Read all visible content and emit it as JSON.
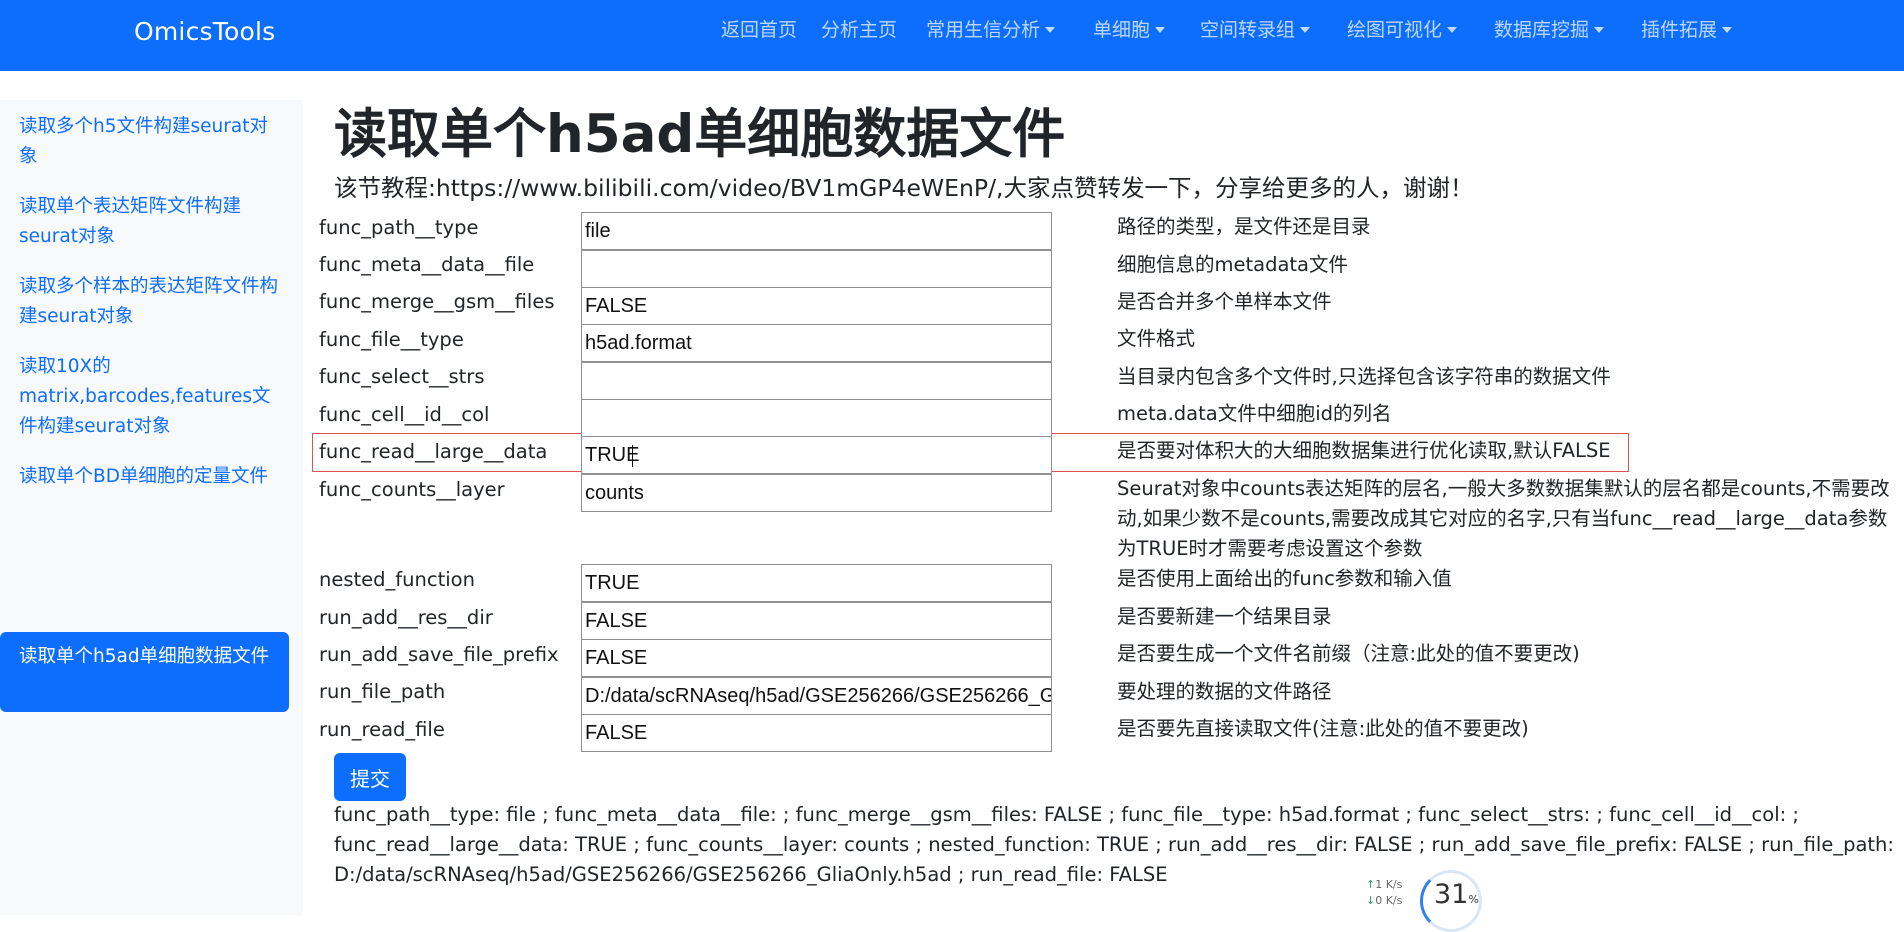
{
  "navbar": {
    "brand": "OmicsTools",
    "items": [
      {
        "label": "返回首页",
        "dropdown": false
      },
      {
        "label": "分析主页",
        "dropdown": false
      },
      {
        "label": "常用生信分析",
        "dropdown": true
      },
      {
        "label": "单细胞",
        "dropdown": true
      },
      {
        "label": "空间转录组",
        "dropdown": true
      },
      {
        "label": "绘图可视化",
        "dropdown": true
      },
      {
        "label": "数据库挖掘",
        "dropdown": true
      },
      {
        "label": "插件拓展",
        "dropdown": true
      }
    ],
    "color": "#0d6efd"
  },
  "sidebar": {
    "items": [
      {
        "label": "读取多个h5文件构建seurat对象",
        "active": false
      },
      {
        "label": "读取单个表达矩阵文件构建seurat对象",
        "active": false
      },
      {
        "label": "读取多个样本的表达矩阵文件构建seurat对象",
        "active": false
      },
      {
        "label": "读取10X的matrix,barcodes,features文件构建seurat对象",
        "active": false
      },
      {
        "label": "读取单个BD单细胞的定量文件",
        "active": false
      },
      {
        "label": "读取单个h5ad单细胞数据文件",
        "active": true
      }
    ]
  },
  "page": {
    "title": "读取单个h5ad单细胞数据文件",
    "tutorial": "该节教程:https://www.bilibili.com/video/BV1mGP4eWEnP/,大家点赞转发一下，分享给更多的人，谢谢！"
  },
  "params": [
    {
      "name": "func_path__type",
      "value": "file",
      "desc": "路径的类型，是文件还是目录"
    },
    {
      "name": "func_meta__data__file",
      "value": "",
      "desc": "细胞信息的metadata文件"
    },
    {
      "name": "func_merge__gsm__files",
      "value": "FALSE",
      "desc": "是否合并多个单样本文件"
    },
    {
      "name": "func_file__type",
      "value": "h5ad.format",
      "desc": "文件格式"
    },
    {
      "name": "func_select__strs",
      "value": "",
      "desc": "当目录内包含多个文件时,只选择包含该字符串的数据文件"
    },
    {
      "name": "func_cell__id__col",
      "value": "",
      "desc": "meta.data文件中细胞id的列名"
    },
    {
      "name": "func_read__large__data",
      "value": "TRUE",
      "desc": "是否要对体积大的大细胞数据集进行优化读取,默认FALSE"
    },
    {
      "name": "func_counts__layer",
      "value": "counts",
      "desc": "Seurat对象中counts表达矩阵的层名,一般大多数数据集默认的层名都是counts,不需要改动,如果少数不是counts,需要改成其它对应的名字,只有当func__read__large__data参数为TRUE时才需要考虑设置这个参数"
    },
    {
      "name": "nested_function",
      "value": "TRUE",
      "desc": "是否使用上面给出的func参数和输入值"
    },
    {
      "name": "run_add__res__dir",
      "value": "FALSE",
      "desc": "是否要新建一个结果目录"
    },
    {
      "name": "run_add_save_file_prefix",
      "value": "FALSE",
      "desc": "是否要生成一个文件名前缀（注意:此处的值不要更改)"
    },
    {
      "name": "run_file_path",
      "value": "D:/data/scRNAseq/h5ad/GSE256266/GSE256266_GliaOnly.h5ad",
      "desc": "要处理的数据的文件路径"
    },
    {
      "name": "run_read_file",
      "value": "FALSE",
      "desc": "是否要先直接读取文件(注意:此处的值不要更改)"
    }
  ],
  "submit_label": "提交",
  "result_text": "func_path__type: file ; func_meta__data__file: ; func_merge__gsm__files: FALSE ; func_file__type: h5ad.format ; func_select__strs: ; func_cell__id__col: ; func_read__large__data: TRUE ; func_counts__layer: counts ; nested_function: TRUE ; run_add__res__dir: FALSE ; run_add_save_file_prefix: FALSE ; run_file_path: D:/data/scRNAseq/h5ad/GSE256266/GSE256266_GliaOnly.h5ad ; run_read_file: FALSE",
  "speed_widget": {
    "up": "1",
    "down": "0",
    "unit": "K/s",
    "percent": "31",
    "percent_sign": "%"
  }
}
